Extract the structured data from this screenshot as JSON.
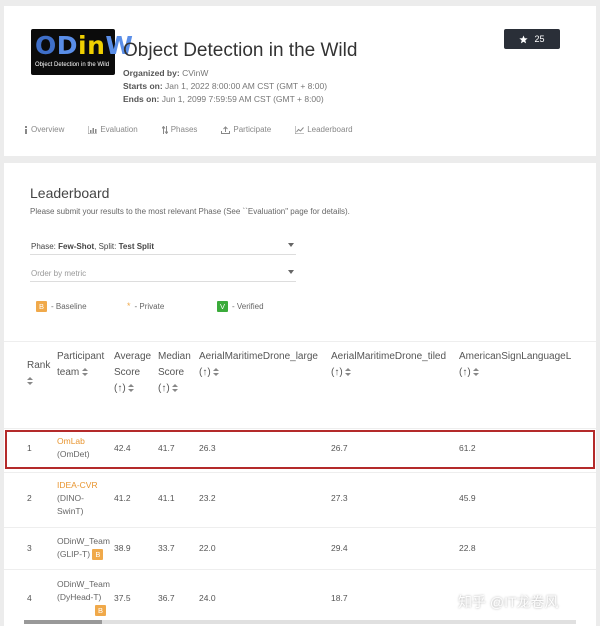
{
  "competition": {
    "logo_text": {
      "o": "O",
      "d": "D",
      "in": "in",
      "w": "W"
    },
    "logo_subtitle": "Object Detection in the Wild",
    "title": "Object Detection in the Wild",
    "organized_label": "Organized by:",
    "organized_value": "CVinW",
    "starts_label": "Starts on:",
    "starts_value": "Jan 1, 2022 8:00:00 AM CST (GMT + 8:00)",
    "ends_label": "Ends on:",
    "ends_value": "Jun 1, 2099 7:59:59 AM CST (GMT + 8:00)",
    "star_count": "25"
  },
  "nav": [
    {
      "label": "Overview",
      "icon": "info-icon"
    },
    {
      "label": "Evaluation",
      "icon": "bar-chart-icon"
    },
    {
      "label": "Phases",
      "icon": "sort-arrows-icon"
    },
    {
      "label": "Participate",
      "icon": "upload-icon"
    },
    {
      "label": "Leaderboard",
      "icon": "line-chart-icon"
    }
  ],
  "leaderboard": {
    "title": "Leaderboard",
    "description": "Please submit your results to the most relevant Phase (See ``Evaluation\" page for details).",
    "phase_label": "Phase:",
    "phase_value": "Few-Shot",
    "split_label": "Split:",
    "split_value": "Test Split",
    "order_placeholder": "Order by metric",
    "legend": {
      "baseline_badge": "B",
      "baseline_label": "- Baseline",
      "private_mark": "*",
      "private_label": "- Private",
      "verified_badge": "V",
      "verified_label": "- Verified"
    },
    "columns": {
      "rank": "Rank",
      "team_1": "Participant",
      "team_2": "team",
      "avg_1": "Average",
      "avg_2": "Score",
      "avg_3": "(↑)",
      "med_1": "Median",
      "med_2": "Score",
      "med_3": "(↑)",
      "c1": "AerialMaritimeDrone_large",
      "c1_dir": "(↑)",
      "c2": "AerialMaritimeDrone_tiled",
      "c2_dir": "(↑)",
      "c3": "AmericanSignLanguageL",
      "c3_dir": "(↑)"
    },
    "rows": [
      {
        "rank": "1",
        "team": "OmLab",
        "team_sub": "(OmDet)",
        "avg": "42.4",
        "median": "41.7",
        "c1": "26.3",
        "c2": "26.7",
        "c3": "61.2"
      },
      {
        "rank": "2",
        "team": "IDEA-CVR",
        "team_sub": "(DINO-",
        "team_sub2": "SwinT)",
        "avg": "41.2",
        "median": "41.1",
        "c1": "23.2",
        "c2": "27.3",
        "c3": "45.9"
      },
      {
        "rank": "3",
        "team": "ODinW_Team",
        "team_sub": "(GLIP-T)",
        "badge": "B",
        "avg": "38.9",
        "median": "33.7",
        "c1": "22.0",
        "c2": "29.4",
        "c3": "22.8"
      },
      {
        "rank": "4",
        "team": "ODinW_Team",
        "team_sub": "(DyHead-T)",
        "badge": "B",
        "avg": "37.5",
        "median": "36.7",
        "c1": "24.0",
        "c2": "18.7",
        "c3": ""
      }
    ]
  },
  "watermark": "知乎 @IT龙卷风",
  "colors": {
    "accent": "#e89530",
    "highlight": "#b42a2a",
    "verified": "#3bab3b",
    "baseline": "#f0a94a"
  }
}
